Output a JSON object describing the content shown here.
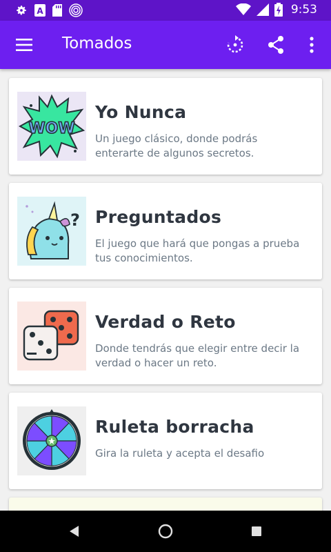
{
  "status_bar": {
    "time": "9:53",
    "icons_left": [
      "gear-icon",
      "font-a-icon",
      "sd-card-icon",
      "spiral-icon"
    ],
    "icons_right": [
      "wifi-icon",
      "signal-icon",
      "battery-charging-icon"
    ]
  },
  "app_bar": {
    "title": "Tomados",
    "icons": [
      "menu-icon",
      "refresh-icon",
      "share-icon",
      "more-vert-icon"
    ],
    "color": "#6d1ff0"
  },
  "cards": [
    {
      "title": "Yo Nunca",
      "description": "Un juego clásico, donde podrás enterarte de algunos secretos.",
      "icon": "wow-burst-icon",
      "thumb_bg": "#ebe6f5"
    },
    {
      "title": "Preguntados",
      "description": "El juego que hará que pongas a prueba tus conocimientos.",
      "icon": "unicorn-question-icon",
      "thumb_bg": "#dff4f7"
    },
    {
      "title": "Verdad o Reto",
      "description": "Donde tendrás que elegir entre decir la verdad o hacer un reto.",
      "icon": "dice-icon",
      "thumb_bg": "#fbe8e4"
    },
    {
      "title": "Ruleta borracha",
      "description": "Gira la ruleta y acepta el desafio",
      "icon": "roulette-wheel-icon",
      "thumb_bg": "#efefef"
    }
  ],
  "nav_bar": {
    "icons": [
      "back-icon",
      "home-icon",
      "recents-icon"
    ]
  }
}
